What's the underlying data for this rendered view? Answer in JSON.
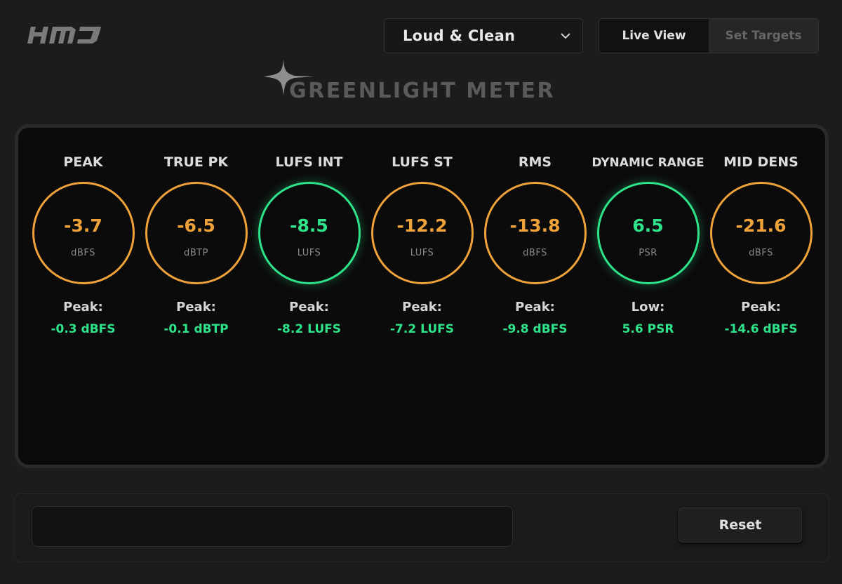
{
  "logo_text": "HMJ",
  "preset": {
    "label": "Loud & Clean"
  },
  "view_toggle": {
    "options": [
      {
        "label": "Live View",
        "active": true
      },
      {
        "label": "Set Targets",
        "active": false
      }
    ]
  },
  "title": "GREENLIGHT METER",
  "colors": {
    "warning": "#f0a23a",
    "ok": "#2fe38a",
    "background": "#1c1c1c",
    "panel": "#0b0b0b"
  },
  "meters": [
    {
      "label": "PEAK",
      "value": "-3.7",
      "unit": "dBFS",
      "status": "warning",
      "stat_label": "Peak:",
      "stat_value": "-0.3 dBFS"
    },
    {
      "label": "TRUE PK",
      "value": "-6.5",
      "unit": "dBTP",
      "status": "warning",
      "stat_label": "Peak:",
      "stat_value": "-0.1 dBTP"
    },
    {
      "label": "LUFS INT",
      "value": "-8.5",
      "unit": "LUFS",
      "status": "ok",
      "stat_label": "Peak:",
      "stat_value": "-8.2 LUFS"
    },
    {
      "label": "LUFS ST",
      "value": "-12.2",
      "unit": "LUFS",
      "status": "warning",
      "stat_label": "Peak:",
      "stat_value": "-7.2 LUFS"
    },
    {
      "label": "RMS",
      "value": "-13.8",
      "unit": "dBFS",
      "status": "warning",
      "stat_label": "Peak:",
      "stat_value": "-9.8 dBFS"
    },
    {
      "label": "DYNAMIC RANGE",
      "value": "6.5",
      "unit": "PSR",
      "status": "ok",
      "stat_label": "Low:",
      "stat_value": "5.6 PSR"
    },
    {
      "label": "MID DENS",
      "value": "-21.6",
      "unit": "dBFS",
      "status": "warning",
      "stat_label": "Peak:",
      "stat_value": "-14.6 dBFS"
    }
  ],
  "footer": {
    "message": "",
    "reset_label": "Reset"
  }
}
